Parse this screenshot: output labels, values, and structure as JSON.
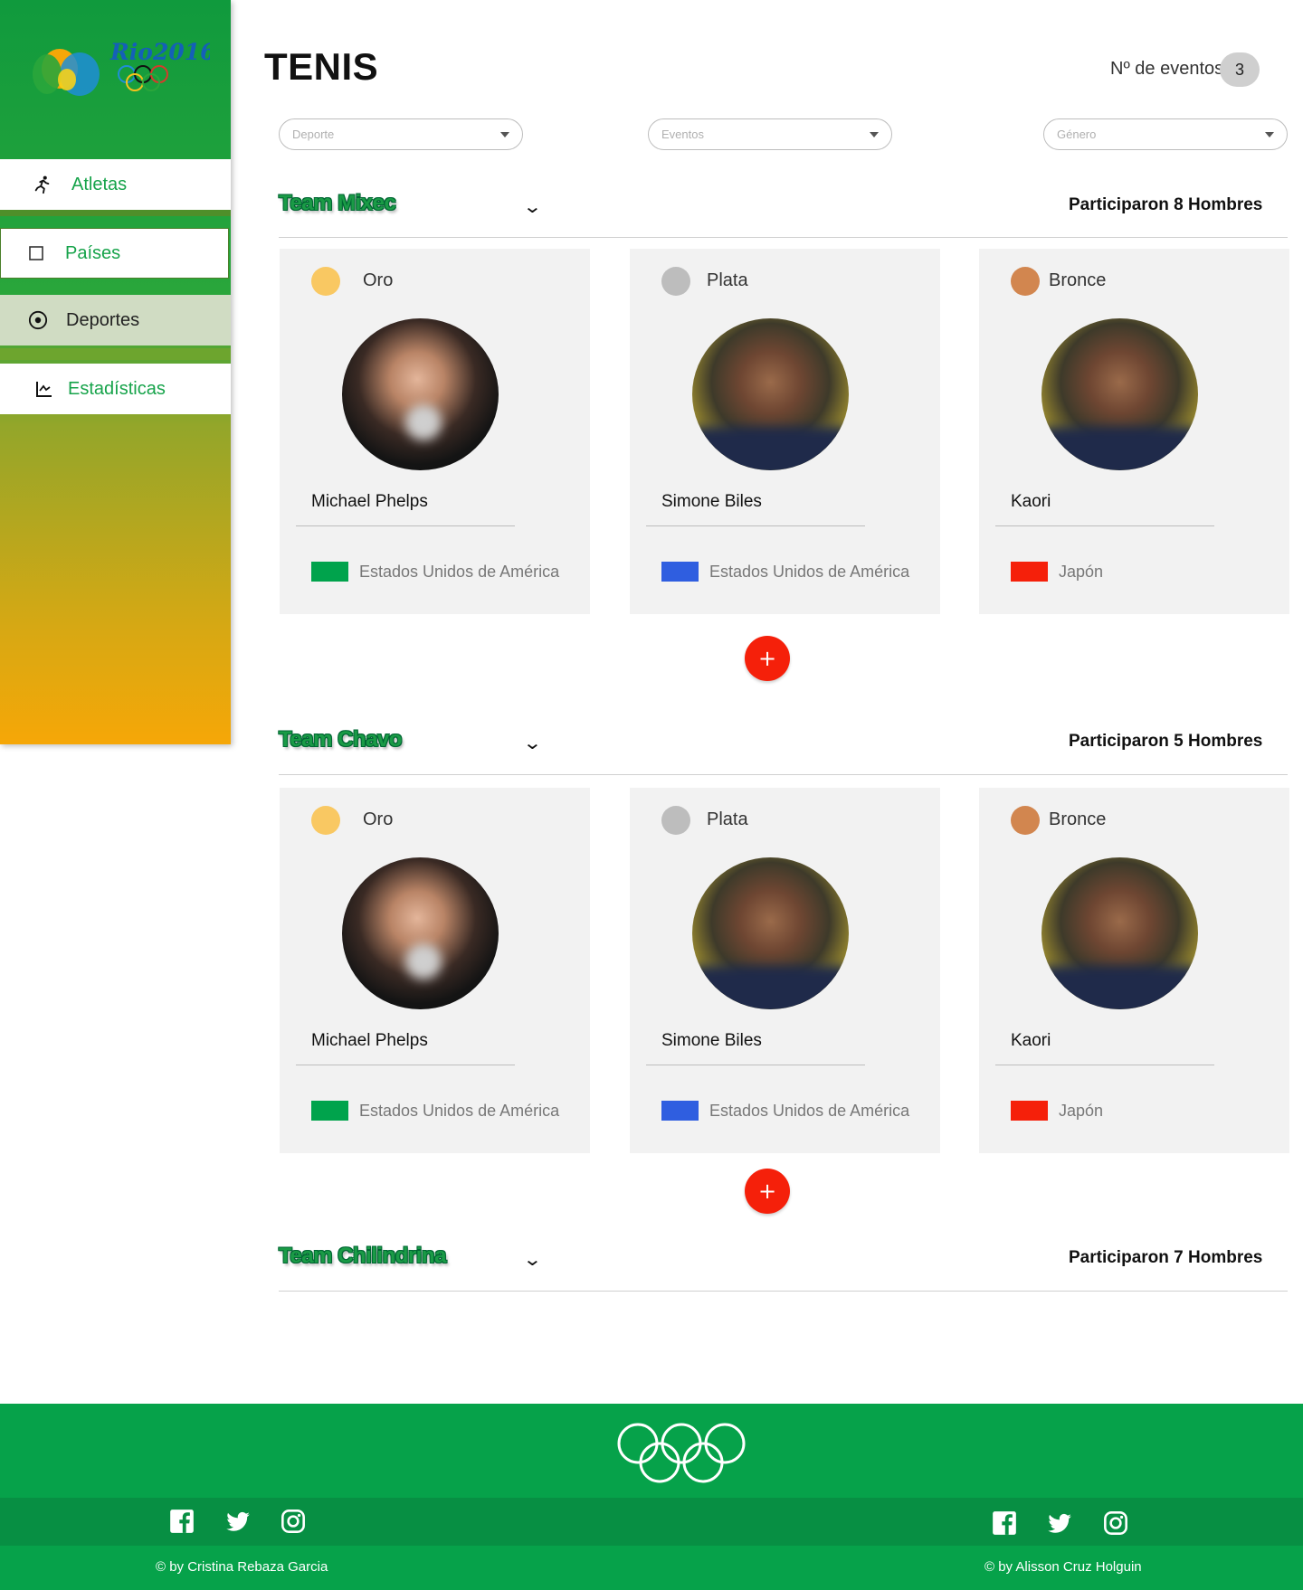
{
  "brand": {
    "logo_text": "Rio2016"
  },
  "sidebar": {
    "items": [
      {
        "label": "Atletas",
        "icon": "runner-icon"
      },
      {
        "label": "Países",
        "icon": "square-icon"
      },
      {
        "label": "Deportes",
        "icon": "soccer-ball-icon"
      },
      {
        "label": "Estadísticas",
        "icon": "chart-icon"
      }
    ]
  },
  "header": {
    "title": "TENIS",
    "events_label": "Nº de eventos",
    "events_count": "3"
  },
  "filters": [
    {
      "placeholder": "Deporte"
    },
    {
      "placeholder": "Eventos"
    },
    {
      "placeholder": "Género"
    }
  ],
  "medals": {
    "gold": "Oro",
    "silver": "Plata",
    "bronze": "Bronce"
  },
  "colors": {
    "gold": "#f9c862",
    "silver": "#bdbdbd",
    "bronze": "#d2864f",
    "flag_green": "#00a34c",
    "flag_blue": "#2f5ee0",
    "flag_red": "#f5200a",
    "brand_green": "#06a24a",
    "accent_red": "#f5200a"
  },
  "teams": [
    {
      "name": "Team Mixec",
      "participants": "Participaron 8 Hombres",
      "cards": [
        {
          "medal": "Oro",
          "athlete": "Michael Phelps",
          "country": "Estados Unidos de América"
        },
        {
          "medal": "Plata",
          "athlete": "Simone Biles",
          "country": "Estados Unidos de América"
        },
        {
          "medal": "Bronce",
          "athlete": "Kaori",
          "country": "Japón"
        }
      ],
      "add_label": "+"
    },
    {
      "name": "Team Chavo",
      "participants": "Participaron 5 Hombres",
      "cards": [
        {
          "medal": "Oro",
          "athlete": "Michael Phelps",
          "country": "Estados Unidos de América"
        },
        {
          "medal": "Plata",
          "athlete": "Simone Biles",
          "country": "Estados Unidos de América"
        },
        {
          "medal": "Bronce",
          "athlete": "Kaori",
          "country": "Japón"
        }
      ],
      "add_label": "+"
    },
    {
      "name": "Team Chilindrina",
      "participants": "Participaron 7 Hombres"
    }
  ],
  "footer": {
    "credit_left": "© by Cristina Rebaza Garcia",
    "credit_right": "© by Alisson Cruz Holguin",
    "social": [
      "facebook-icon",
      "twitter-icon",
      "instagram-icon"
    ]
  }
}
